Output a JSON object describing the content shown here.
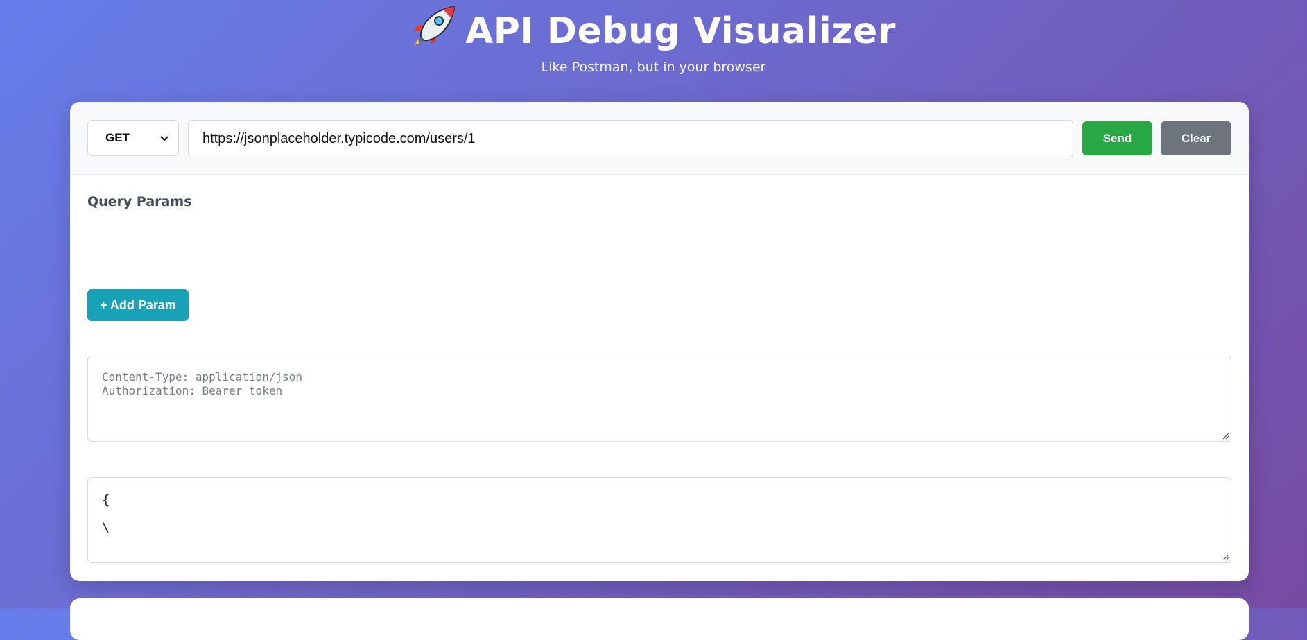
{
  "header": {
    "title": "API Debug Visualizer",
    "subtitle": "Like Postman, but in your browser",
    "icon": "rocket-icon"
  },
  "request": {
    "method": "GET",
    "url": "https://jsonplaceholder.typicode.com/users/1",
    "send_label": "Send",
    "clear_label": "Clear"
  },
  "params": {
    "section_label": "Query Params",
    "add_label": "+ Add Param"
  },
  "headers_field": {
    "placeholder_line1": "Content-Type: application/json",
    "placeholder_line2": "Authorization: Bearer token"
  },
  "body_field": {
    "line1": "{",
    "line2": "\\"
  },
  "colors": {
    "send": "#28a745",
    "clear": "#6c757d",
    "add_param": "#17a2b8",
    "background_start": "#667eea",
    "background_end": "#764ba2"
  }
}
